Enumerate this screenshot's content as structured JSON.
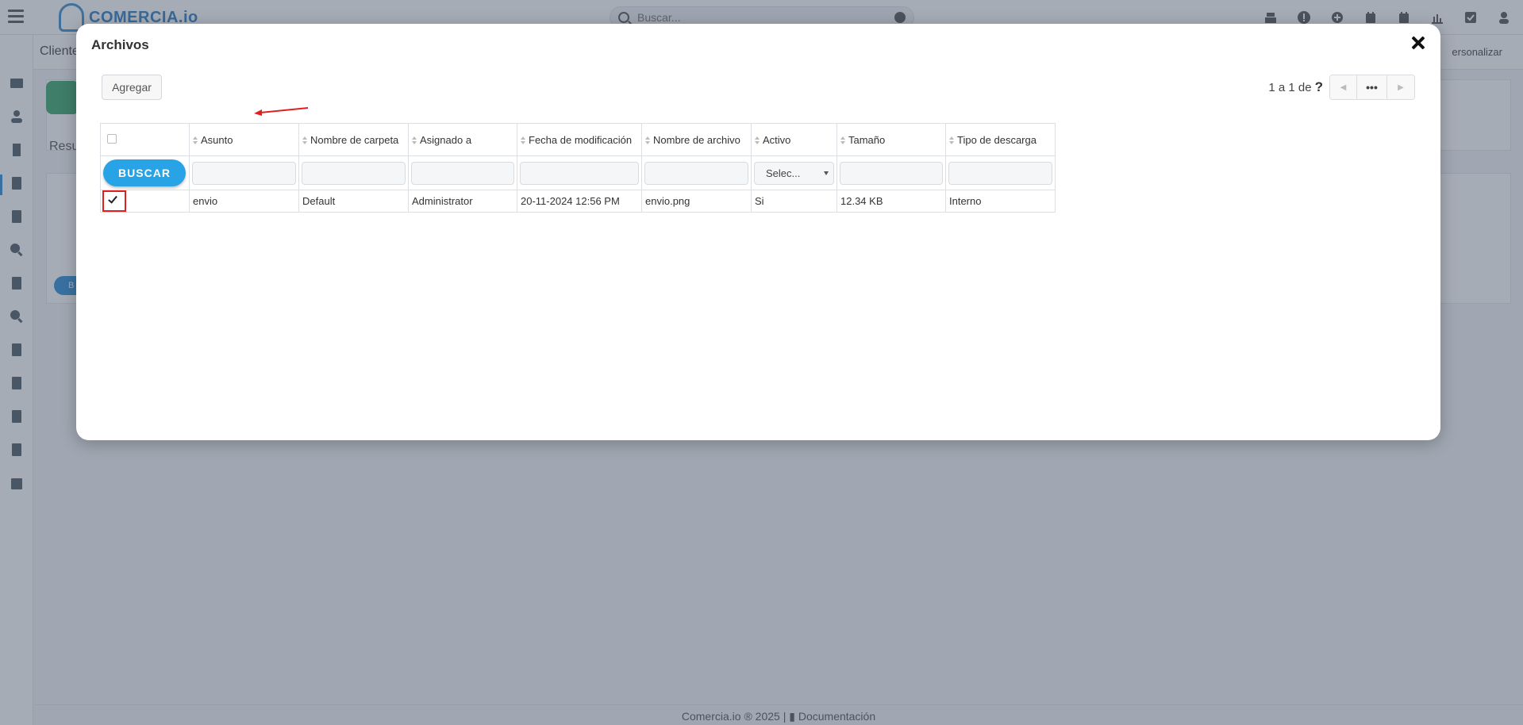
{
  "app": {
    "logo_text": "COMERCIA.io",
    "search_placeholder": "Buscar...",
    "module_title": "Cliente",
    "personalize_label": "ersonalizar",
    "tab_fragment": "Resu",
    "ghost_button_fragment": "B",
    "footer": {
      "copyright": "Comercia.io ® 2025",
      "separator": "|",
      "docs_label": "Documentación"
    }
  },
  "modal": {
    "title": "Archivos",
    "add_label": "Agregar",
    "pager": {
      "range_text": "1 a 1  de",
      "total_unknown": "?",
      "more_label": "•••"
    },
    "search_button_label": "BUSCAR",
    "select_placeholder": "Selec...",
    "columns": [
      {
        "label": "Asunto"
      },
      {
        "label": "Nombre de carpeta"
      },
      {
        "label": "Asignado a"
      },
      {
        "label": "Fecha de modificación"
      },
      {
        "label": "Nombre de archivo"
      },
      {
        "label": "Activo"
      },
      {
        "label": "Tamaño"
      },
      {
        "label": "Tipo de descarga"
      }
    ],
    "rows": [
      {
        "checked": true,
        "asunto": "envio",
        "carpeta": "Default",
        "asignado": "Administrator",
        "fecha": "20-11-2024 12:56 PM",
        "archivo": "envio.png",
        "activo": "Si",
        "tamano": "12.34 KB",
        "tipo_descarga": "Interno"
      }
    ]
  },
  "colors": {
    "accent": "#27a3e6",
    "highlight": "#e02020",
    "module": "#3aa86b"
  }
}
